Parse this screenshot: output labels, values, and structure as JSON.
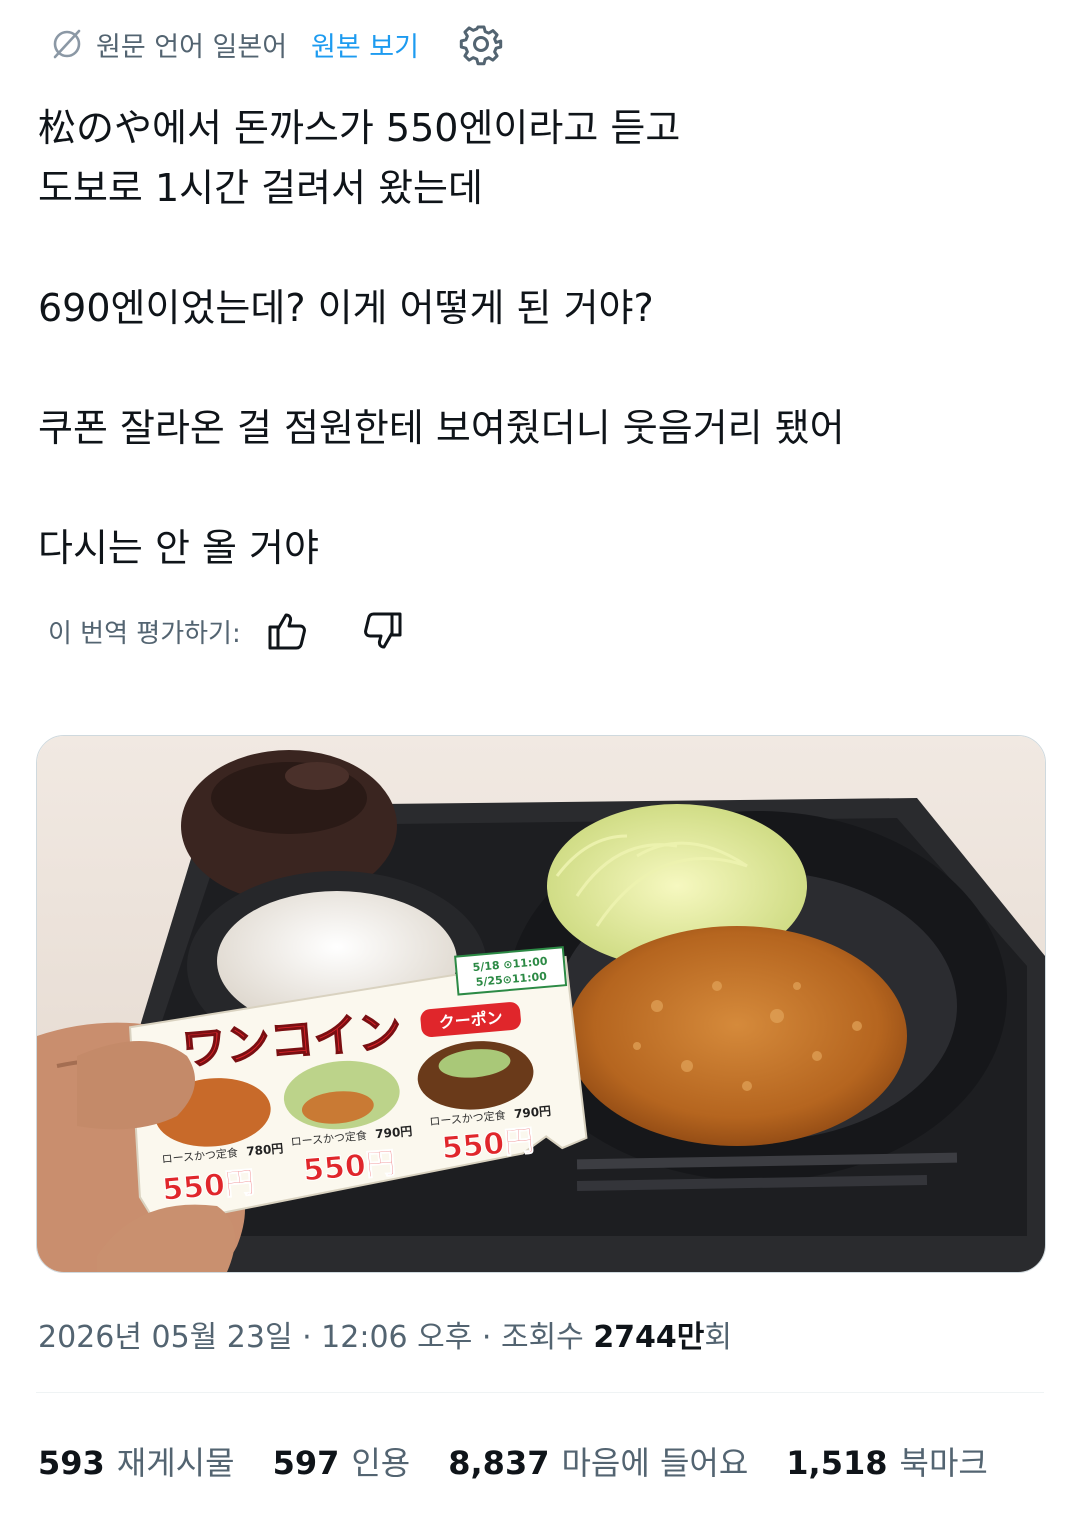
{
  "translation": {
    "source_language_label": "원문 언어 일본어",
    "show_original_label": "원본 보기"
  },
  "tweet": {
    "lines": [
      "松のや에서 돈까스가 550엔이라고 듣고",
      "도보로 1시간 걸려서 왔는데",
      "690엔이었는데? 이게 어떻게 된 거야?",
      "쿠폰 잘라온 걸 점원한테 보여줬더니 웃음거리 됐어",
      "다시는 안 올 거야"
    ]
  },
  "rating": {
    "label": "이 번역 평가하기:"
  },
  "coupon": {
    "title": "ワンコイン",
    "subtitle": "クーポン",
    "date_1": "5/18 ⊙11:00",
    "date_2": "5/25⊙11:00",
    "items": [
      {
        "name": "ロースかつ定食",
        "old_price": "780円",
        "price": "550円"
      },
      {
        "name": "ロースかつ定食",
        "old_price": "790円",
        "price": "550円"
      },
      {
        "name": "ロースかつ定食",
        "old_price": "790円",
        "price": "550円"
      }
    ]
  },
  "meta": {
    "datetime": "2026년 05월 23일 · 12:06 오후 · 조회수 ",
    "views": "2744만",
    "views_unit": "회"
  },
  "stats": {
    "retweets": {
      "count": "593",
      "label": "재게시물"
    },
    "quotes": {
      "count": "597",
      "label": "인용"
    },
    "likes": {
      "count": "8,837",
      "label": "마음에 들어요"
    },
    "bookmarks": {
      "count": "1,518",
      "label": "북마크"
    }
  },
  "colors": {
    "link": "#1d9bf0",
    "secondary_text": "#536471",
    "primary_text": "#0f1419",
    "divider": "#eff3f4"
  },
  "icons": [
    "translate-globe-icon",
    "settings-gear-icon",
    "thumbs-up-icon",
    "thumbs-down-icon"
  ]
}
